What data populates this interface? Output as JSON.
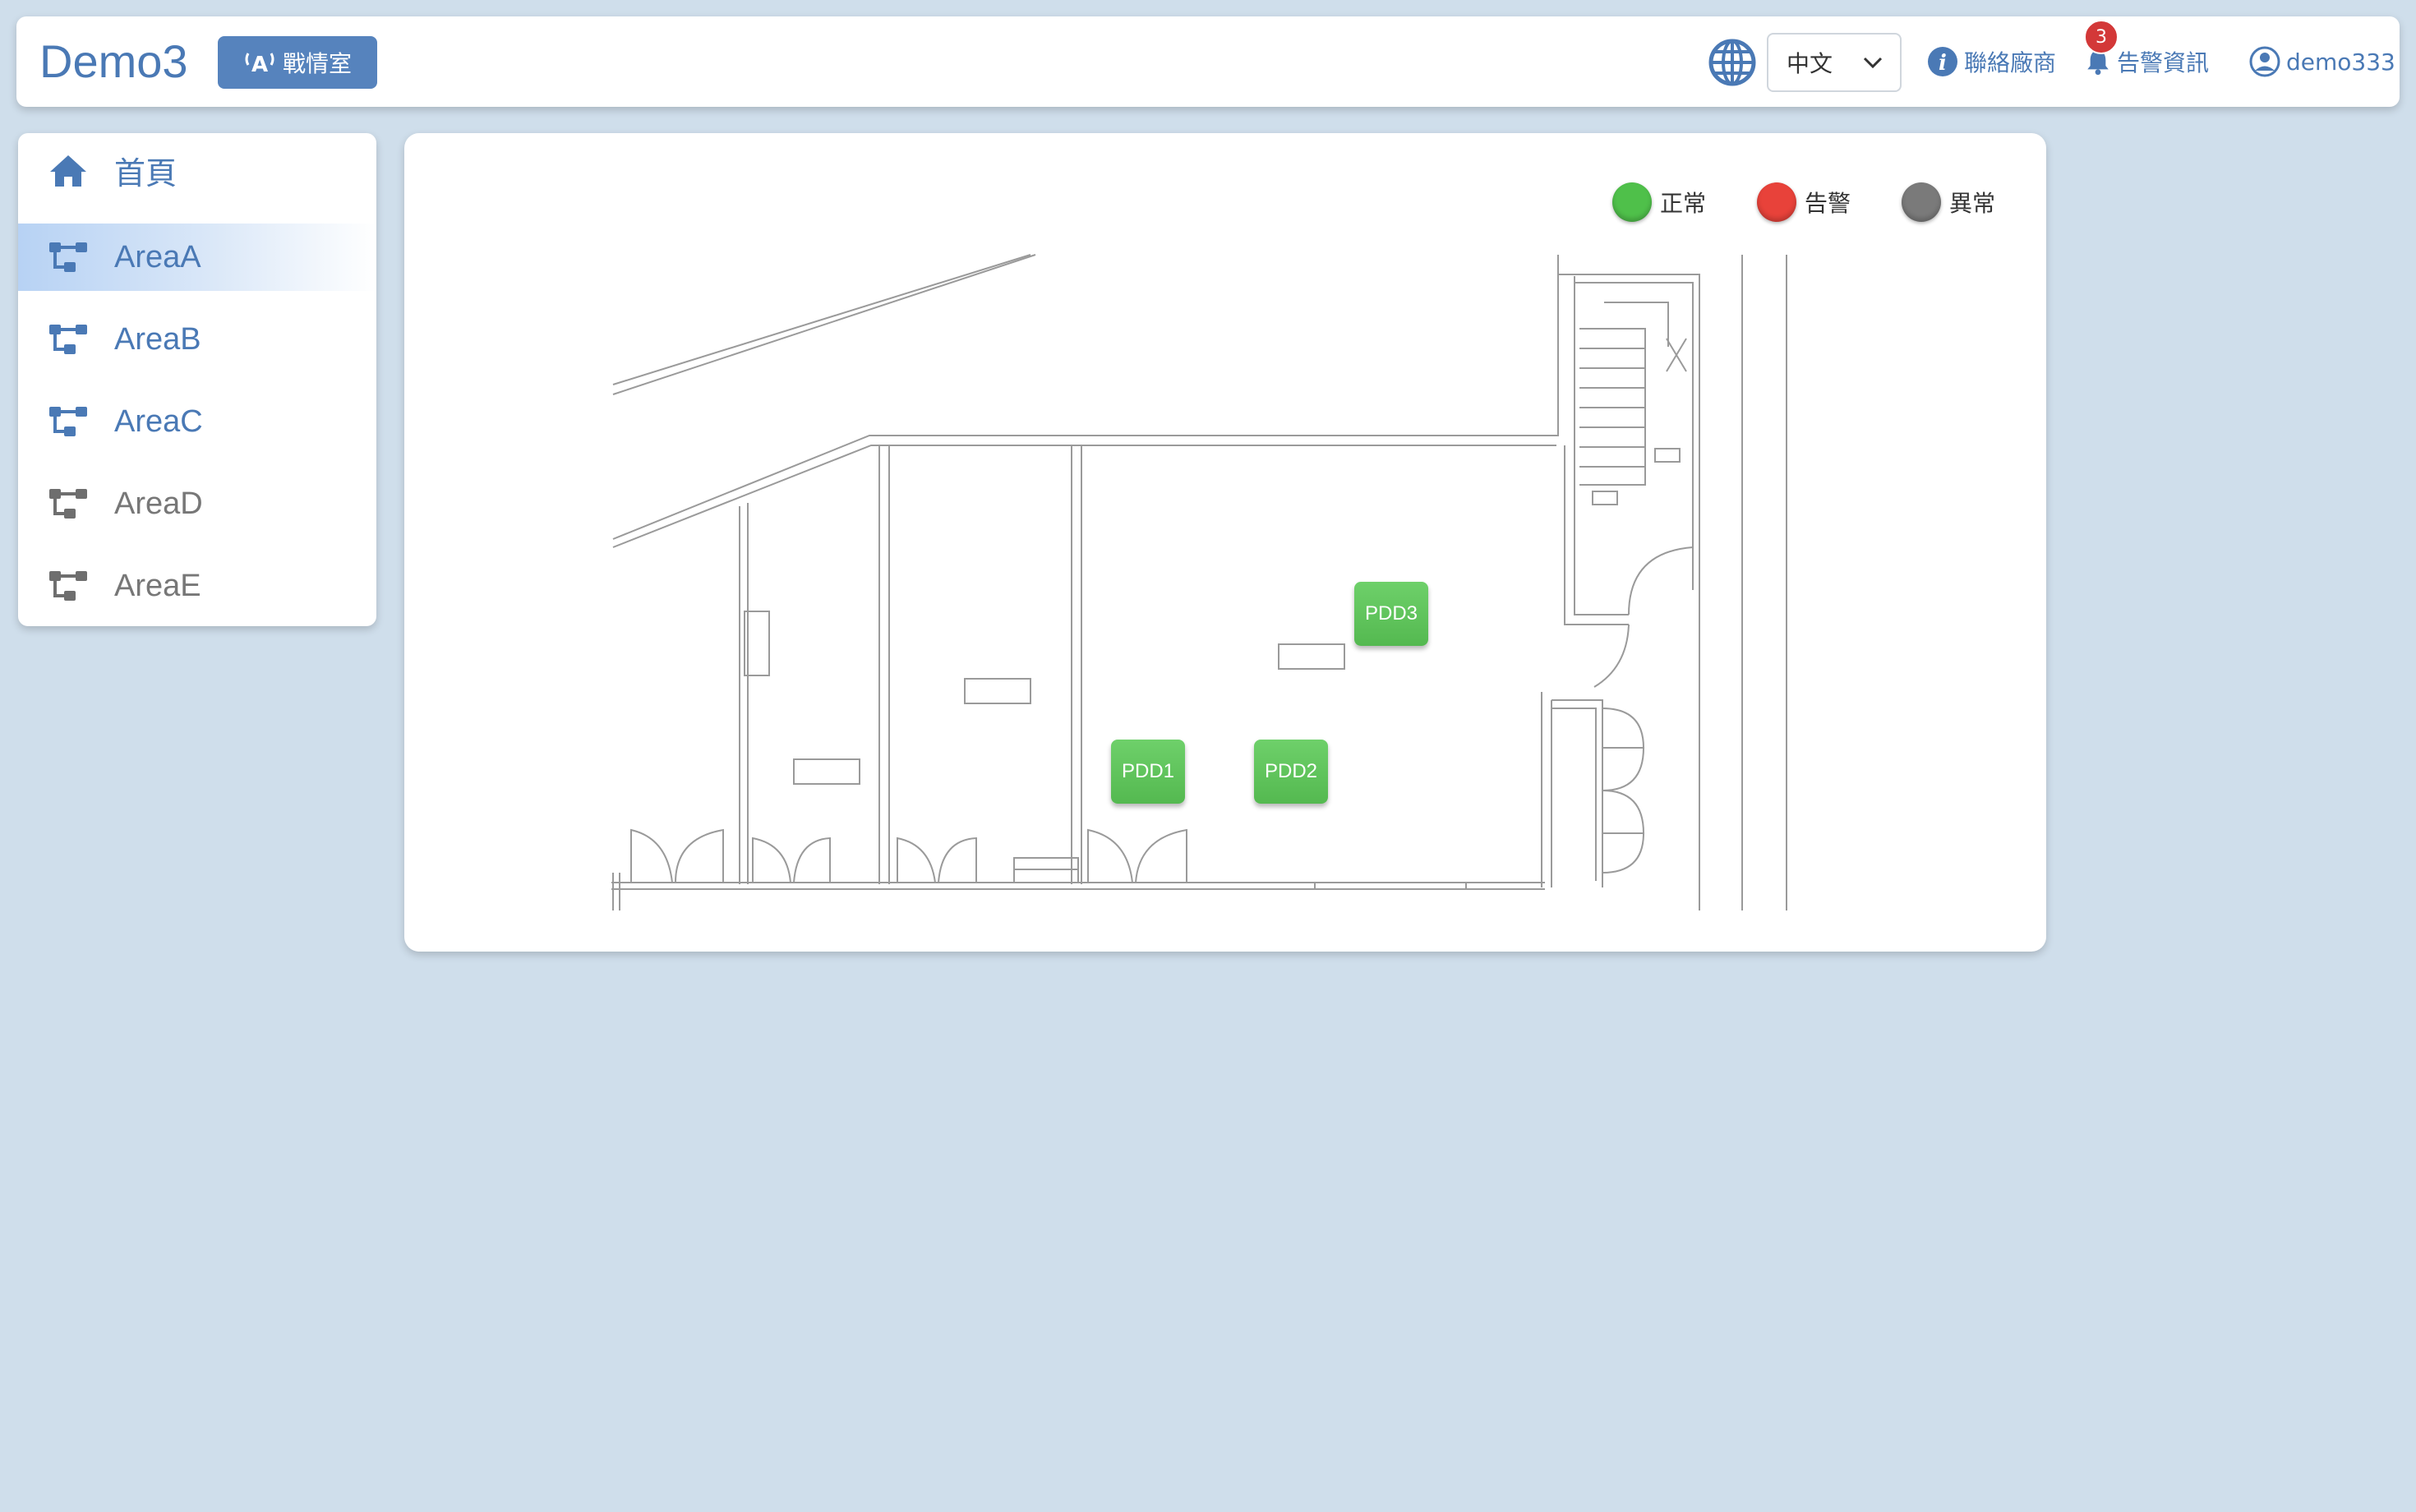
{
  "header": {
    "brand": "Demo3",
    "war_room_label": "戰情室",
    "language_value": "中文",
    "contact_label": "聯絡廠商",
    "alerts_label": "告警資訊",
    "alerts_count": "3",
    "username": "demo333"
  },
  "sidebar": {
    "items": [
      {
        "label": "首頁",
        "icon": "home-icon"
      },
      {
        "label": "AreaA",
        "icon": "network-icon",
        "active": true
      },
      {
        "label": "AreaB",
        "icon": "network-icon"
      },
      {
        "label": "AreaC",
        "icon": "network-icon"
      },
      {
        "label": "AreaD",
        "icon": "network-icon"
      },
      {
        "label": "AreaE",
        "icon": "network-icon"
      }
    ]
  },
  "legend": [
    {
      "label": "正常",
      "color": "#4fc04a"
    },
    {
      "label": "告警",
      "color": "#e8423a"
    },
    {
      "label": "異常",
      "color": "#7a7a7a"
    }
  ],
  "devices": [
    {
      "label": "PDD1",
      "status": "正常"
    },
    {
      "label": "PDD2",
      "status": "正常"
    },
    {
      "label": "PDD3",
      "status": "正常"
    }
  ],
  "colors": {
    "accent": "#4a79b5",
    "background": "#cfdeeb",
    "badge": "#d33838"
  }
}
